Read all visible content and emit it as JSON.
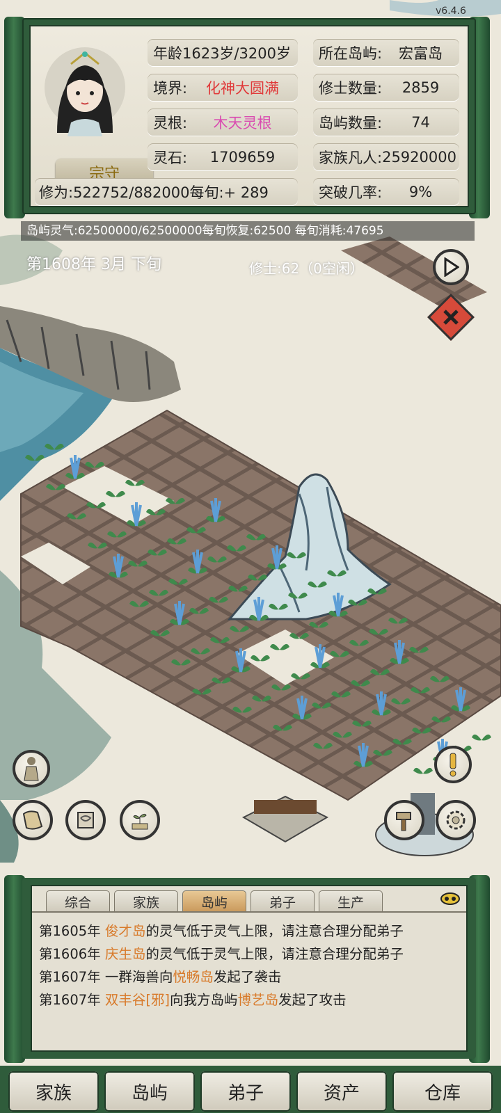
{
  "version": "v6.4.6",
  "player": {
    "rank_label": "宗守",
    "age_label": "年龄",
    "age_value": "1623岁/3200岁",
    "realm_label": "境界:",
    "realm_value": "化神大圆满",
    "root_label": "灵根:",
    "root_value": "木天灵根",
    "stones_label": "灵石:",
    "stones_value": "1709659",
    "cultivation_text": "修为:522752/882000每旬:+ 289",
    "island_label": "所在岛屿:",
    "island_value": "宏富岛",
    "cultivators_label": "修士数量:",
    "cultivators_value": "2859",
    "islands_label": "岛屿数量:",
    "islands_value": "74",
    "mortals_label": "家族凡人:",
    "mortals_value": "25920000",
    "breakthrough_label": "突破几率:",
    "breakthrough_value": "9%"
  },
  "island_qi": "岛屿灵气:62500000/62500000每旬恢复:62500 每旬消耗:47695",
  "date_text": "第1608年 3月 下旬",
  "cultivators_text": "修士:62（0空闲）",
  "log": {
    "tabs": [
      "综合",
      "家族",
      "岛屿",
      "弟子",
      "生产"
    ],
    "active_tab": 2,
    "lines": [
      {
        "pre": "第1605年 ",
        "hl": "俊才岛",
        "post": "的灵气低于灵气上限，请注意合理分配弟子"
      },
      {
        "pre": "第1606年 ",
        "hl": "庆生岛",
        "post": "的灵气低于灵气上限，请注意合理分配弟子"
      },
      {
        "pre": "第1607年 一群海兽向",
        "hl": "悦畅岛",
        "post": "发起了袭击"
      },
      {
        "pre": "第1607年 ",
        "hl": "双丰谷[邪]",
        "post": "向我方岛屿",
        "hl2": "博艺岛",
        "post2": "发起了攻击"
      }
    ]
  },
  "nav": [
    "家族",
    "岛屿",
    "弟子",
    "资产",
    "仓库"
  ],
  "icons": {
    "play": "play-icon",
    "close": "close-icon",
    "disciple": "disciple-figure-icon",
    "alert": "exclamation-icon",
    "map": "map-icon",
    "scroll": "scroll-icon",
    "seed": "seedling-icon",
    "hammer": "hammer-icon",
    "gear": "gear-icon"
  },
  "colors": {
    "panel_green": "#2f5c3b",
    "realm_red": "#e03a3a",
    "root_pink": "#d94bb0",
    "highlight_orange": "#d87a2a"
  }
}
